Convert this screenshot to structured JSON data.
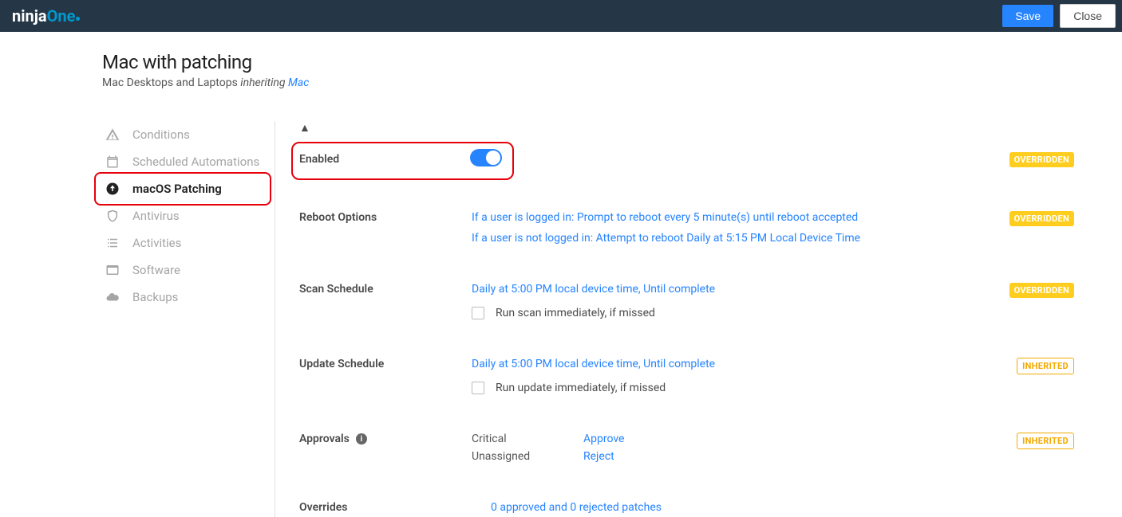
{
  "header": {
    "logo_a": "ninja",
    "logo_b": "One",
    "save_label": "Save",
    "close_label": "Close"
  },
  "page": {
    "title": "Mac with patching",
    "subtitle_prefix": "Mac Desktops and Laptops ",
    "subtitle_inh": "inheriting ",
    "subtitle_link": "Mac"
  },
  "sidebar": {
    "items": [
      {
        "label": "Conditions"
      },
      {
        "label": "Scheduled Automations"
      },
      {
        "label": "macOS Patching"
      },
      {
        "label": "Antivirus"
      },
      {
        "label": "Activities"
      },
      {
        "label": "Software"
      },
      {
        "label": "Backups"
      }
    ]
  },
  "badges": {
    "overridden": "OVERRIDDEN",
    "inherited": "INHERITED"
  },
  "enabled": {
    "label": "Enabled"
  },
  "reboot": {
    "label": "Reboot Options",
    "line1": "If a user is logged in: Prompt to reboot every 5 minute(s) until reboot accepted",
    "line2": "If a user is not logged in: Attempt to reboot Daily at 5:15 PM Local Device Time"
  },
  "scan": {
    "label": "Scan Schedule",
    "value": "Daily at 5:00 PM local device time, Until complete",
    "checkbox": "Run scan immediately, if missed"
  },
  "update": {
    "label": "Update Schedule",
    "value": "Daily at 5:00 PM local device time, Until complete",
    "checkbox": "Run update immediately, if missed"
  },
  "approvals": {
    "label": "Approvals",
    "rows": [
      {
        "k": "Critical",
        "v": "Approve"
      },
      {
        "k": "Unassigned",
        "v": "Reject"
      }
    ]
  },
  "overrides": {
    "label": "Overrides",
    "value": "0 approved and 0 rejected patches"
  }
}
